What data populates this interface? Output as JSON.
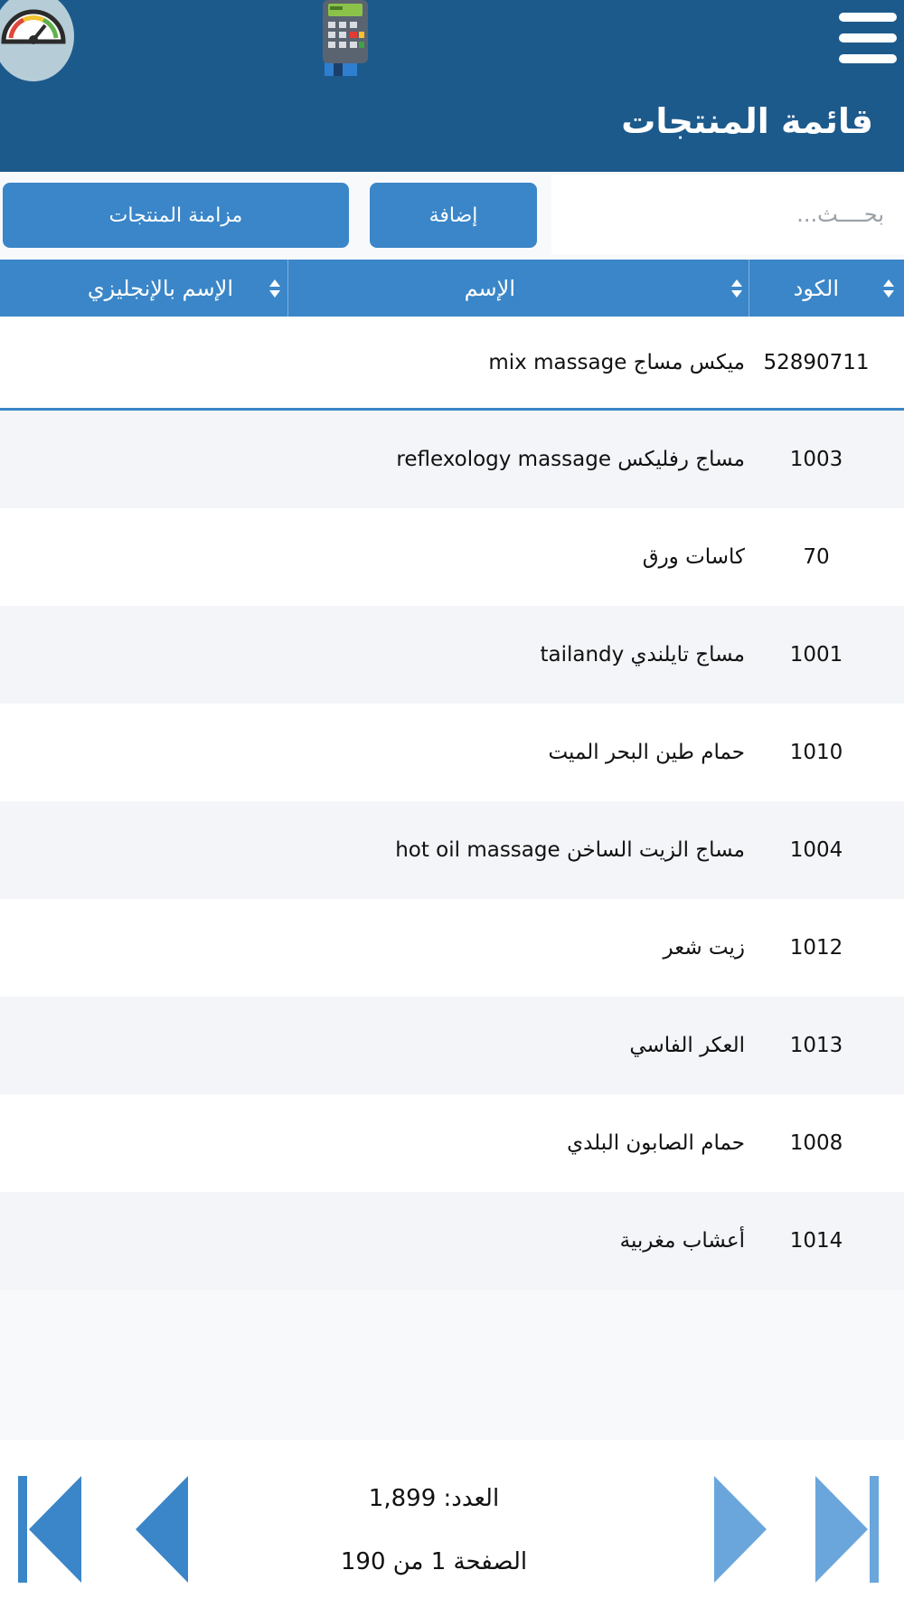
{
  "header": {
    "title": "قائمة المنتجات"
  },
  "toolbar": {
    "search_placeholder": "بحــــث...",
    "add_label": "إضافة",
    "sync_label": "مزامنة المنتجات"
  },
  "table": {
    "columns": {
      "code": "الكود",
      "name": "الإسم",
      "english_name": "الإسم بالإنجليزي"
    },
    "rows": [
      {
        "code": "52890711",
        "name": "ميكس مساج mix massage"
      },
      {
        "code": "1003",
        "name": "مساج رفليكس reflexology massage"
      },
      {
        "code": "70",
        "name": "كاسات ورق"
      },
      {
        "code": "1001",
        "name": "مساج تايلندي tailandy"
      },
      {
        "code": "1010",
        "name": "حمام طين البحر الميت"
      },
      {
        "code": "1004",
        "name": "مساج الزيت الساخن hot oil massage"
      },
      {
        "code": "1012",
        "name": "زيت شعر"
      },
      {
        "code": "1013",
        "name": "العكر الفاسي"
      },
      {
        "code": "1008",
        "name": "حمام الصابون البلدي"
      },
      {
        "code": "1014",
        "name": "أعشاب مغربية"
      }
    ]
  },
  "footer": {
    "count_text": "العدد: 1,899",
    "page_text": "الصفحة 1 من 190"
  },
  "icons": {
    "dashboard": "speedometer-icon",
    "pos": "pos-terminal-icon",
    "menu": "hamburger-menu-icon",
    "sort": "sort-arrows-icon",
    "first": "first-page-icon",
    "prev": "previous-page-icon",
    "next": "next-page-icon",
    "last": "last-page-icon"
  },
  "colors": {
    "header_bg": "#1d5a8c",
    "accent": "#3a86c8",
    "nav_light": "#6aa6db"
  }
}
